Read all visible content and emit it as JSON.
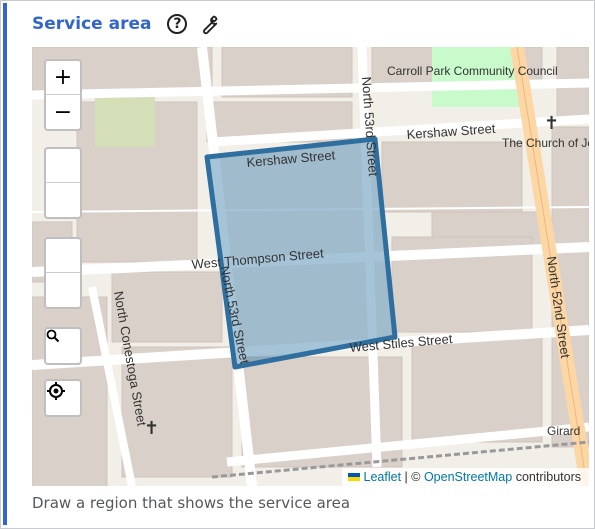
{
  "header": {
    "title": "Service area",
    "help_icon": "question-circle-icon",
    "edit_icon": "wrench-icon"
  },
  "map": {
    "controls": {
      "zoom_in": "+",
      "zoom_out": "−",
      "search_icon": "search-icon",
      "locate_icon": "locate-icon"
    },
    "street_labels": {
      "kershaw_top": "Kershaw Street",
      "kershaw_right": "Kershaw Street",
      "west_thompson": "West Thompson Street",
      "west_stiles": "West Stiles Street",
      "north_53rd": "North 53rd Street",
      "north_53rd_lower": "North 53rd Street",
      "north_52nd": "North 52nd Street",
      "north_conestoga": "North Conestoga Street"
    },
    "poi_labels": {
      "park": "Carroll Park Community Council",
      "church": "The Church of Jesus Christ of Philadelphia",
      "girard": "Girard"
    },
    "attribution": {
      "leaflet": "Leaflet",
      "separator": "| ©",
      "osm": "OpenStreetMap",
      "contributors": "contributors"
    },
    "polygon_color": "#3a7ca8"
  },
  "hint": "Draw a region that shows the service area"
}
